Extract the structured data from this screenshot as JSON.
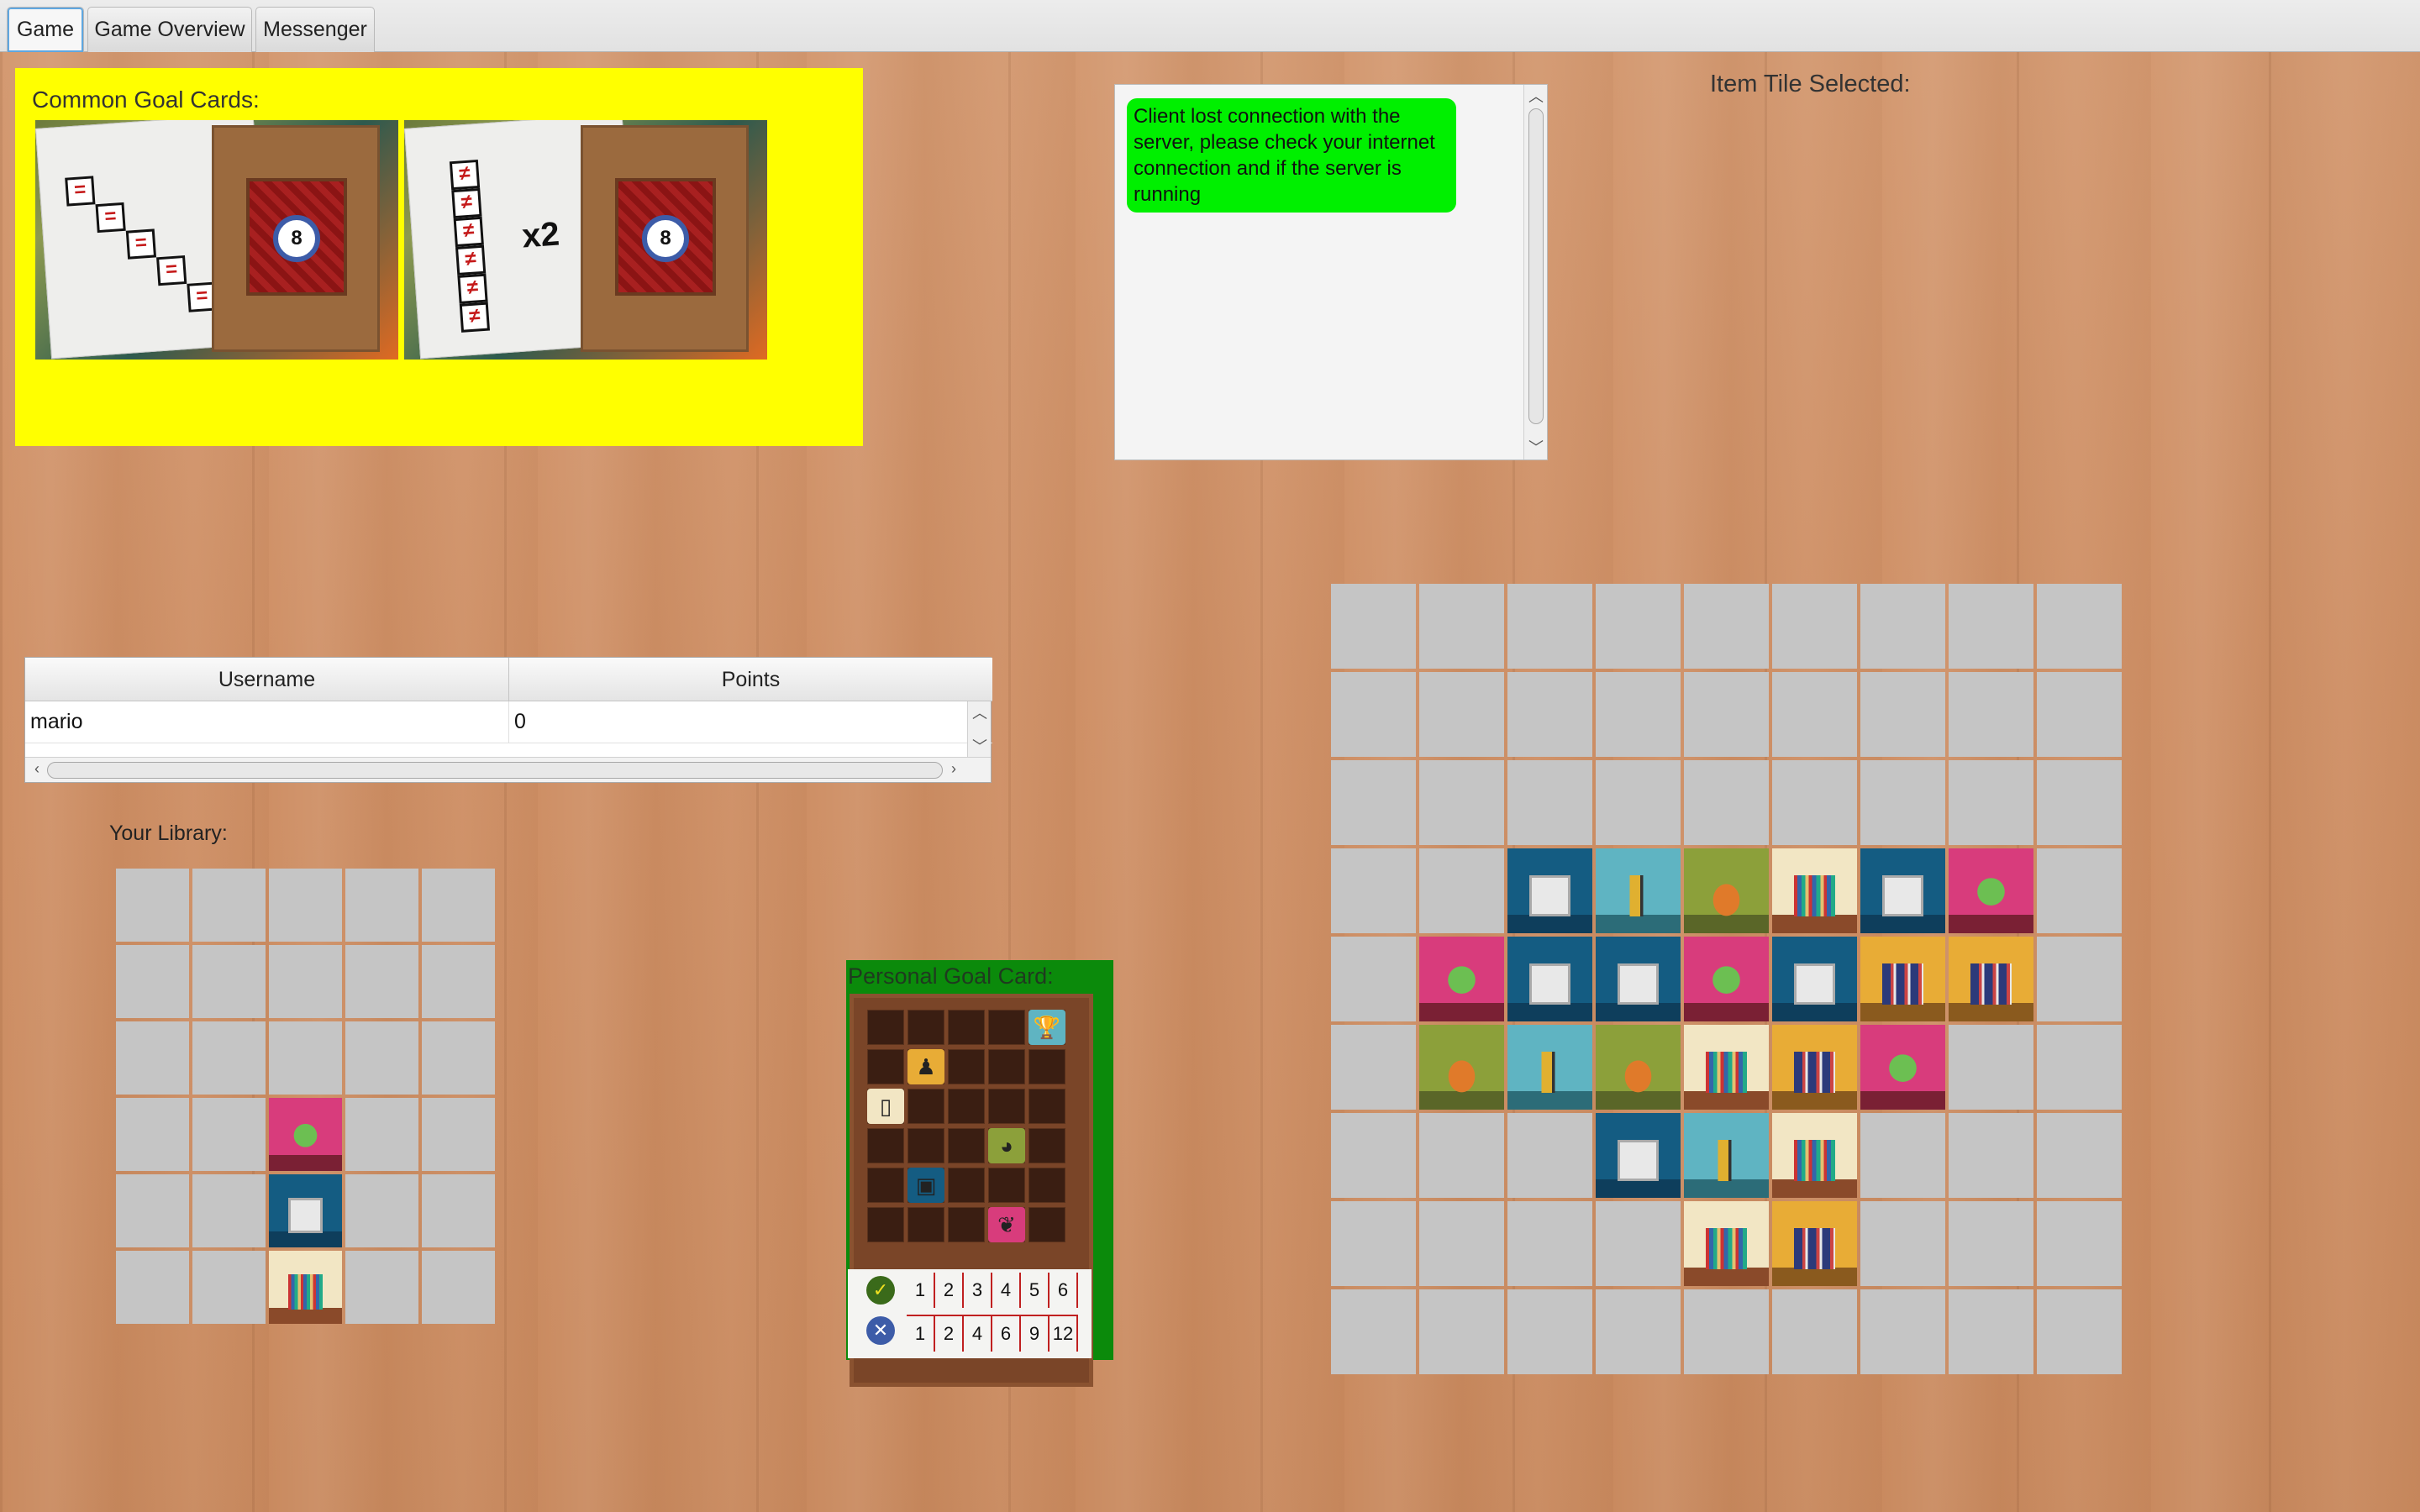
{
  "tabs": [
    {
      "label": "Game",
      "active": true
    },
    {
      "label": "Game Overview",
      "active": false
    },
    {
      "label": "Messenger",
      "active": false
    }
  ],
  "common_goals": {
    "title": "Common Goal Cards:",
    "cards": [
      {
        "token_value": "8",
        "symbol": "="
      },
      {
        "token_value": "8",
        "symbol": "≠",
        "multiplier": "x2"
      }
    ]
  },
  "messages": [
    {
      "text": "Client lost connection with the server, please check your internet connection and if the server is running",
      "color": "#00f000"
    }
  ],
  "item_tile_selected": {
    "label": "Item Tile Selected:"
  },
  "scoreboard": {
    "columns": [
      "Username",
      "Points"
    ],
    "rows": [
      {
        "username": "mario",
        "points": "0"
      }
    ]
  },
  "library": {
    "label": "Your Library:",
    "rows": 6,
    "cols": 5,
    "tiles": [
      {
        "row": 3,
        "col": 2,
        "type": "plants"
      },
      {
        "row": 4,
        "col": 2,
        "type": "frames"
      },
      {
        "row": 5,
        "col": 2,
        "type": "books"
      }
    ]
  },
  "personal_goal": {
    "label": "Personal Goal Card:",
    "targets": [
      {
        "row": 0,
        "col": 4,
        "type": "trophies",
        "icon": "trophy-icon"
      },
      {
        "row": 1,
        "col": 1,
        "type": "games",
        "icon": "meeple-icon"
      },
      {
        "row": 2,
        "col": 0,
        "type": "books",
        "icon": "book-icon"
      },
      {
        "row": 3,
        "col": 3,
        "type": "cats",
        "icon": "cat-icon"
      },
      {
        "row": 4,
        "col": 1,
        "type": "frames",
        "icon": "frame-icon"
      },
      {
        "row": 5,
        "col": 3,
        "type": "plants",
        "icon": "leaf-icon"
      }
    ],
    "matches_row": [
      "1",
      "2",
      "3",
      "4",
      "5",
      "6"
    ],
    "points_row": [
      "1",
      "2",
      "4",
      "6",
      "9",
      "12"
    ]
  },
  "board": {
    "rows": 9,
    "cols": 9,
    "tiles": [
      {
        "row": 3,
        "col": 2,
        "type": "frames"
      },
      {
        "row": 3,
        "col": 3,
        "type": "trophies"
      },
      {
        "row": 3,
        "col": 4,
        "type": "cats"
      },
      {
        "row": 3,
        "col": 5,
        "type": "books"
      },
      {
        "row": 3,
        "col": 6,
        "type": "frames"
      },
      {
        "row": 3,
        "col": 7,
        "type": "plants"
      },
      {
        "row": 4,
        "col": 1,
        "type": "plants"
      },
      {
        "row": 4,
        "col": 2,
        "type": "frames"
      },
      {
        "row": 4,
        "col": 3,
        "type": "frames"
      },
      {
        "row": 4,
        "col": 4,
        "type": "plants"
      },
      {
        "row": 4,
        "col": 5,
        "type": "frames"
      },
      {
        "row": 4,
        "col": 6,
        "type": "games"
      },
      {
        "row": 4,
        "col": 7,
        "type": "games"
      },
      {
        "row": 5,
        "col": 1,
        "type": "cats"
      },
      {
        "row": 5,
        "col": 2,
        "type": "trophies"
      },
      {
        "row": 5,
        "col": 3,
        "type": "cats"
      },
      {
        "row": 5,
        "col": 4,
        "type": "books"
      },
      {
        "row": 5,
        "col": 5,
        "type": "games"
      },
      {
        "row": 5,
        "col": 6,
        "type": "plants"
      },
      {
        "row": 6,
        "col": 3,
        "type": "frames"
      },
      {
        "row": 6,
        "col": 4,
        "type": "trophies"
      },
      {
        "row": 6,
        "col": 5,
        "type": "books"
      },
      {
        "row": 7,
        "col": 4,
        "type": "books"
      },
      {
        "row": 7,
        "col": 5,
        "type": "games"
      }
    ]
  }
}
